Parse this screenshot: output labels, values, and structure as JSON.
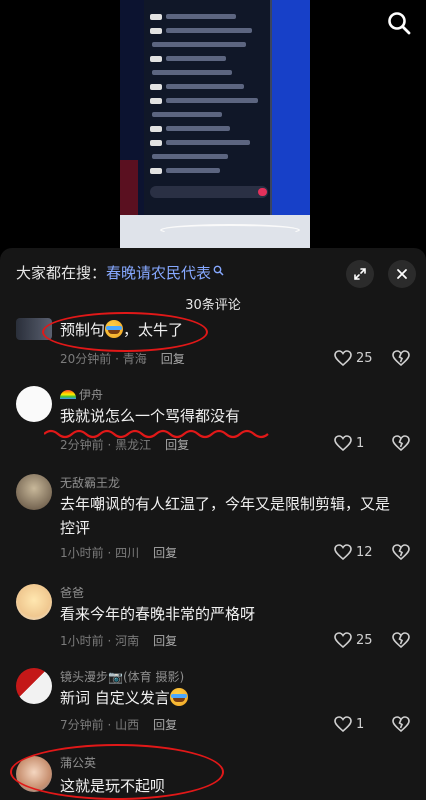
{
  "search_bar": {
    "prefix": "大家都在搜：",
    "term": "春晚请农民代表"
  },
  "comment_count": "30条评论",
  "comments": [
    {
      "username": "",
      "text_before": "预制句",
      "has_emoji": true,
      "text_after": "，太牛了",
      "time_location": "20分钟前 · 青海",
      "reply": "回复",
      "likes": "25"
    },
    {
      "username": "伊舟",
      "text": "我就说怎么一个骂得都没有",
      "time_location": "2分钟前 · 黑龙江",
      "reply": "回复",
      "likes": "1"
    },
    {
      "username": "无敌霸王龙",
      "text": "去年嘲讽的有人红温了，今年又是限制剪辑，又是控评",
      "time_location": "1小时前 · 四川",
      "reply": "回复",
      "likes": "12"
    },
    {
      "username": "爸爸",
      "text": "看来今年的春晚非常的严格呀",
      "time_location": "1小时前 · 河南",
      "reply": "回复",
      "likes": "25"
    },
    {
      "username": "镜头漫步📷(体育 摄影)",
      "text_before": "新词 自定义发言",
      "has_emoji": true,
      "time_location": "7分钟前 · 山西",
      "reply": "回复",
      "likes": "1"
    },
    {
      "username": "蒲公英",
      "text": "这就是玩不起呗"
    }
  ],
  "icons": {
    "search": "search-icon",
    "expand": "expand-icon",
    "close": "close-icon",
    "like": "heart-icon",
    "dislike": "broken-heart-icon"
  },
  "colors": {
    "panel_bg": "#161616",
    "search_term": "#86a8ff",
    "annotation_red": "#e11818"
  }
}
